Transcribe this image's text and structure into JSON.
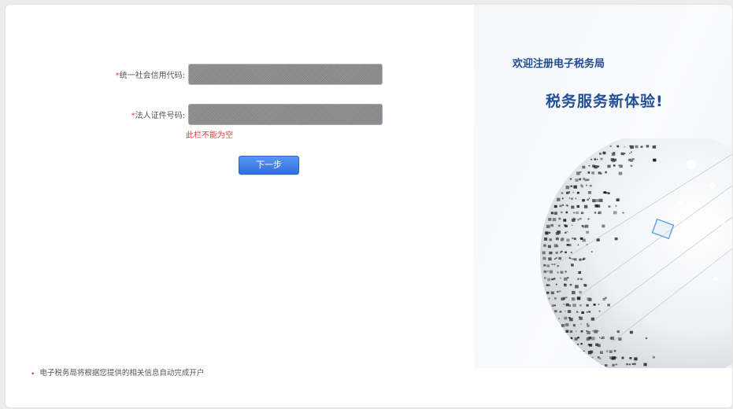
{
  "form": {
    "credit_code": {
      "required_mark": "*",
      "label": "统一社会信用代码:",
      "value": "",
      "placeholder": ""
    },
    "legal_id": {
      "required_mark": "*",
      "label": "法人证件号码:",
      "value": "",
      "placeholder": "",
      "error": "此栏不能为空"
    },
    "next_button_label": "下一步"
  },
  "footer": {
    "bullet": "•",
    "note": "电子税务局将根据您提供的相关信息自动完成开户"
  },
  "banner": {
    "welcome": "欢迎注册电子税务局",
    "slogan": "税务服务新体验!"
  },
  "colors": {
    "accent": "#2f6fe0",
    "error": "#e23b3b",
    "heading": "#1f4c92"
  },
  "icons": {
    "globe": "digital-globe-illustration"
  }
}
